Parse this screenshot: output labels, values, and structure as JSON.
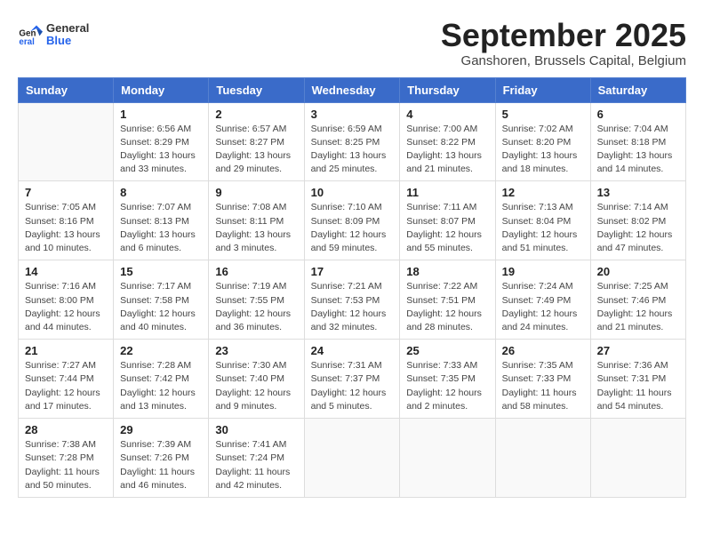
{
  "header": {
    "logo": {
      "general": "General",
      "blue": "Blue"
    },
    "title": "September 2025",
    "location": "Ganshoren, Brussels Capital, Belgium"
  },
  "weekdays": [
    "Sunday",
    "Monday",
    "Tuesday",
    "Wednesday",
    "Thursday",
    "Friday",
    "Saturday"
  ],
  "weeks": [
    [
      {
        "day": "",
        "info": ""
      },
      {
        "day": "1",
        "info": "Sunrise: 6:56 AM\nSunset: 8:29 PM\nDaylight: 13 hours\nand 33 minutes."
      },
      {
        "day": "2",
        "info": "Sunrise: 6:57 AM\nSunset: 8:27 PM\nDaylight: 13 hours\nand 29 minutes."
      },
      {
        "day": "3",
        "info": "Sunrise: 6:59 AM\nSunset: 8:25 PM\nDaylight: 13 hours\nand 25 minutes."
      },
      {
        "day": "4",
        "info": "Sunrise: 7:00 AM\nSunset: 8:22 PM\nDaylight: 13 hours\nand 21 minutes."
      },
      {
        "day": "5",
        "info": "Sunrise: 7:02 AM\nSunset: 8:20 PM\nDaylight: 13 hours\nand 18 minutes."
      },
      {
        "day": "6",
        "info": "Sunrise: 7:04 AM\nSunset: 8:18 PM\nDaylight: 13 hours\nand 14 minutes."
      }
    ],
    [
      {
        "day": "7",
        "info": "Sunrise: 7:05 AM\nSunset: 8:16 PM\nDaylight: 13 hours\nand 10 minutes."
      },
      {
        "day": "8",
        "info": "Sunrise: 7:07 AM\nSunset: 8:13 PM\nDaylight: 13 hours\nand 6 minutes."
      },
      {
        "day": "9",
        "info": "Sunrise: 7:08 AM\nSunset: 8:11 PM\nDaylight: 13 hours\nand 3 minutes."
      },
      {
        "day": "10",
        "info": "Sunrise: 7:10 AM\nSunset: 8:09 PM\nDaylight: 12 hours\nand 59 minutes."
      },
      {
        "day": "11",
        "info": "Sunrise: 7:11 AM\nSunset: 8:07 PM\nDaylight: 12 hours\nand 55 minutes."
      },
      {
        "day": "12",
        "info": "Sunrise: 7:13 AM\nSunset: 8:04 PM\nDaylight: 12 hours\nand 51 minutes."
      },
      {
        "day": "13",
        "info": "Sunrise: 7:14 AM\nSunset: 8:02 PM\nDaylight: 12 hours\nand 47 minutes."
      }
    ],
    [
      {
        "day": "14",
        "info": "Sunrise: 7:16 AM\nSunset: 8:00 PM\nDaylight: 12 hours\nand 44 minutes."
      },
      {
        "day": "15",
        "info": "Sunrise: 7:17 AM\nSunset: 7:58 PM\nDaylight: 12 hours\nand 40 minutes."
      },
      {
        "day": "16",
        "info": "Sunrise: 7:19 AM\nSunset: 7:55 PM\nDaylight: 12 hours\nand 36 minutes."
      },
      {
        "day": "17",
        "info": "Sunrise: 7:21 AM\nSunset: 7:53 PM\nDaylight: 12 hours\nand 32 minutes."
      },
      {
        "day": "18",
        "info": "Sunrise: 7:22 AM\nSunset: 7:51 PM\nDaylight: 12 hours\nand 28 minutes."
      },
      {
        "day": "19",
        "info": "Sunrise: 7:24 AM\nSunset: 7:49 PM\nDaylight: 12 hours\nand 24 minutes."
      },
      {
        "day": "20",
        "info": "Sunrise: 7:25 AM\nSunset: 7:46 PM\nDaylight: 12 hours\nand 21 minutes."
      }
    ],
    [
      {
        "day": "21",
        "info": "Sunrise: 7:27 AM\nSunset: 7:44 PM\nDaylight: 12 hours\nand 17 minutes."
      },
      {
        "day": "22",
        "info": "Sunrise: 7:28 AM\nSunset: 7:42 PM\nDaylight: 12 hours\nand 13 minutes."
      },
      {
        "day": "23",
        "info": "Sunrise: 7:30 AM\nSunset: 7:40 PM\nDaylight: 12 hours\nand 9 minutes."
      },
      {
        "day": "24",
        "info": "Sunrise: 7:31 AM\nSunset: 7:37 PM\nDaylight: 12 hours\nand 5 minutes."
      },
      {
        "day": "25",
        "info": "Sunrise: 7:33 AM\nSunset: 7:35 PM\nDaylight: 12 hours\nand 2 minutes."
      },
      {
        "day": "26",
        "info": "Sunrise: 7:35 AM\nSunset: 7:33 PM\nDaylight: 11 hours\nand 58 minutes."
      },
      {
        "day": "27",
        "info": "Sunrise: 7:36 AM\nSunset: 7:31 PM\nDaylight: 11 hours\nand 54 minutes."
      }
    ],
    [
      {
        "day": "28",
        "info": "Sunrise: 7:38 AM\nSunset: 7:28 PM\nDaylight: 11 hours\nand 50 minutes."
      },
      {
        "day": "29",
        "info": "Sunrise: 7:39 AM\nSunset: 7:26 PM\nDaylight: 11 hours\nand 46 minutes."
      },
      {
        "day": "30",
        "info": "Sunrise: 7:41 AM\nSunset: 7:24 PM\nDaylight: 11 hours\nand 42 minutes."
      },
      {
        "day": "",
        "info": ""
      },
      {
        "day": "",
        "info": ""
      },
      {
        "day": "",
        "info": ""
      },
      {
        "day": "",
        "info": ""
      }
    ]
  ]
}
